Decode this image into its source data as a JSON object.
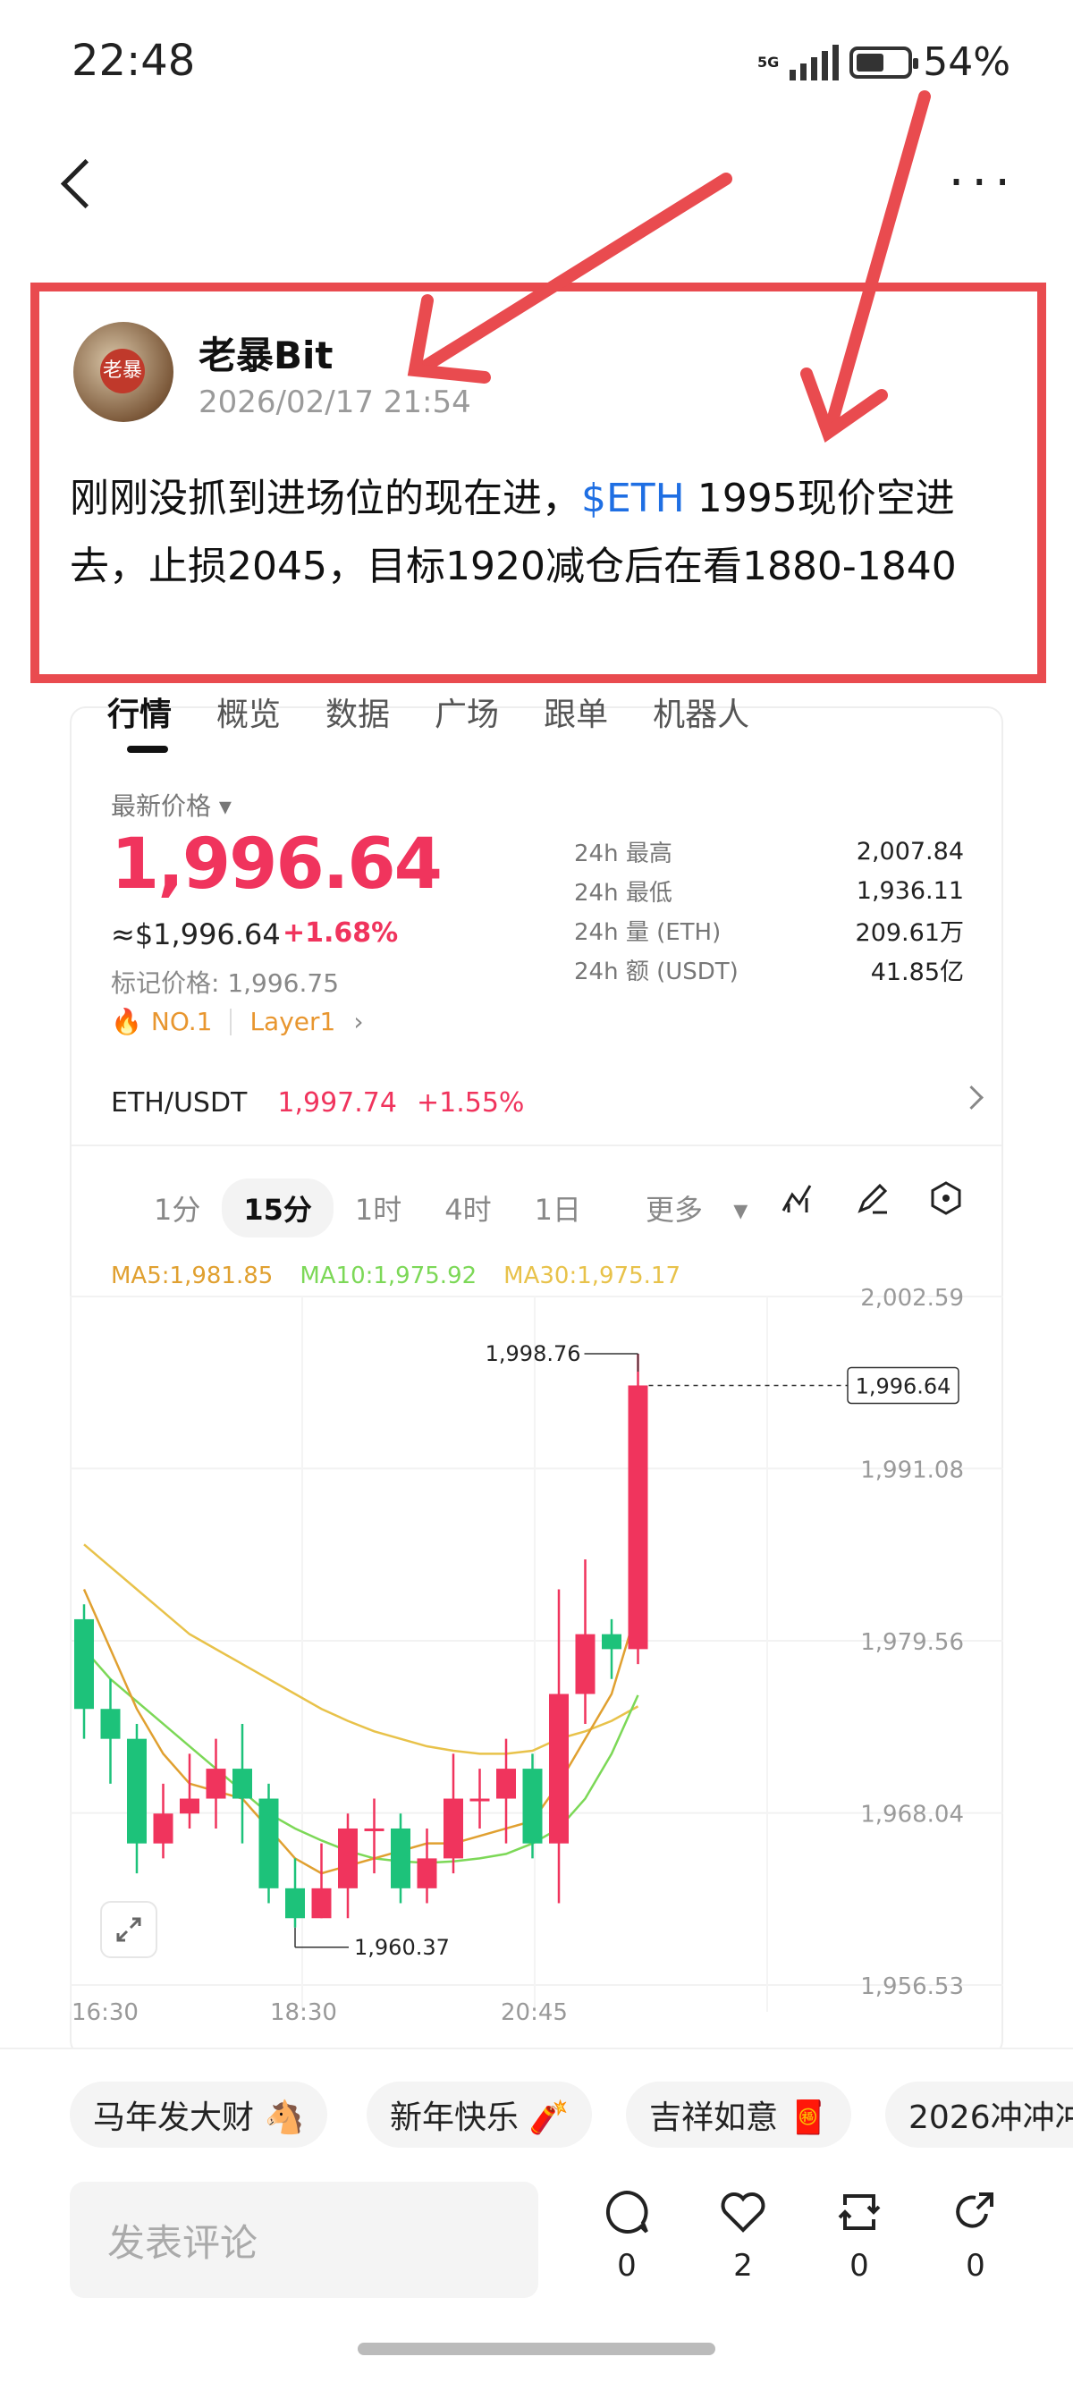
{
  "status": {
    "time": "22:48",
    "network": "5G",
    "battery": "54%"
  },
  "post": {
    "author": "老暴Bit",
    "avatar_text": "老暴",
    "timestamp": "2026/02/17 21:54",
    "text_before": "刚刚没抓到进场位的现在进，",
    "tag": "$ETH",
    "text_after": " 1995现价空进去，止损2045，目标1920减仓后在看1880-1840"
  },
  "tabs": [
    "行情",
    "概览",
    "数据",
    "广场",
    "跟单",
    "机器人"
  ],
  "market": {
    "latest_label": "最新价格",
    "price": "1,996.64",
    "usd_price": "≈$1,996.64",
    "change": "+1.68%",
    "mark_price": "标记价格: 1,996.75",
    "rank_badge": "NO.1",
    "sector_badge": "Layer1",
    "stats": [
      {
        "label": "24h  最高",
        "value": "2,007.84"
      },
      {
        "label": "24h  最低",
        "value": "1,936.11"
      },
      {
        "label": "24h  量 (ETH)",
        "value": "209.61万"
      },
      {
        "label": "24h  额 (USDT)",
        "value": "41.85亿"
      }
    ],
    "pair": {
      "name": "ETH/USDT",
      "price": "1,997.74",
      "change": "+1.55%"
    }
  },
  "intervals": [
    "1分",
    "15分",
    "1时",
    "4时",
    "1日",
    "更多"
  ],
  "active_interval": "15分",
  "icons": [
    "indicator-icon",
    "pen-icon",
    "settings-hex-icon"
  ],
  "chart_data": {
    "type": "candlestick",
    "ma_labels": {
      "ma5": "MA5:1,981.85",
      "ma10": "MA10:1,975.92",
      "ma30": "MA30:1,975.17"
    },
    "y_ticks": [
      "2,002.59",
      "1,991.08",
      "1,979.56",
      "1,968.04",
      "1,956.53"
    ],
    "x_ticks": [
      "16:30",
      "18:30",
      "20:45"
    ],
    "ylim": [
      1956.53,
      2002.59
    ],
    "high_label": "1,998.76",
    "low_label": "1,960.37",
    "current_label": "1,996.64",
    "candles": [
      [
        1981,
        1975,
        1982,
        1973
      ],
      [
        1975,
        1973,
        1977,
        1970
      ],
      [
        1973,
        1966,
        1974,
        1964
      ],
      [
        1966,
        1968,
        1970,
        1965
      ],
      [
        1968,
        1969,
        1972,
        1967
      ],
      [
        1969,
        1971,
        1973,
        1967
      ],
      [
        1971,
        1969,
        1974,
        1966
      ],
      [
        1969,
        1963,
        1970,
        1962
      ],
      [
        1963,
        1961,
        1965,
        1960.37
      ],
      [
        1961,
        1963,
        1966,
        1961
      ],
      [
        1963,
        1967,
        1968,
        1961
      ],
      [
        1967,
        1967,
        1969,
        1964
      ],
      [
        1967,
        1963,
        1968,
        1962
      ],
      [
        1963,
        1965,
        1967,
        1962
      ],
      [
        1965,
        1969,
        1972,
        1964
      ],
      [
        1969,
        1969,
        1971,
        1967
      ],
      [
        1969,
        1971,
        1973,
        1966
      ],
      [
        1971,
        1966,
        1972,
        1965
      ],
      [
        1966,
        1976,
        1983,
        1962
      ],
      [
        1976,
        1980,
        1985,
        1974
      ],
      [
        1980,
        1979,
        1981,
        1977
      ],
      [
        1979,
        1996.64,
        1998.76,
        1978
      ]
    ],
    "ma5": [
      1983,
      1979,
      1975,
      1972,
      1970,
      1969.5,
      1969,
      1967,
      1965,
      1964,
      1964.5,
      1965,
      1965.5,
      1966,
      1966,
      1966.5,
      1967,
      1967.5,
      1970,
      1973,
      1976,
      1981.85
    ],
    "ma10": [
      1979,
      1977,
      1975.5,
      1974,
      1972.5,
      1971,
      1969.5,
      1968,
      1967,
      1966.2,
      1965.5,
      1965,
      1964.8,
      1964.7,
      1964.8,
      1965,
      1965.3,
      1966,
      1967,
      1969,
      1972,
      1975.92
    ],
    "ma30": [
      1986,
      1984.5,
      1983,
      1981.5,
      1980,
      1979,
      1978,
      1977,
      1976,
      1975,
      1974.2,
      1973.5,
      1973,
      1972.5,
      1972.2,
      1972,
      1972,
      1972.2,
      1973,
      1973.5,
      1974.2,
      1975.17
    ]
  },
  "chips": [
    "马年发大财 🐴",
    "新年快乐 🧨",
    "吉祥如意 🧧",
    "2026冲冲冲"
  ],
  "comment_placeholder": "发表评论",
  "actions": [
    {
      "icon": "comment-icon",
      "count": "0"
    },
    {
      "icon": "heart-icon",
      "count": "2"
    },
    {
      "icon": "repost-icon",
      "count": "0"
    },
    {
      "icon": "share-icon",
      "count": "0"
    }
  ],
  "colors": {
    "up": "#f0345d",
    "down": "#1dc27a",
    "ma5": "#e0a030",
    "ma10": "#7cd857",
    "ma30": "#e8c24a",
    "annotation": "#e94b4f"
  }
}
